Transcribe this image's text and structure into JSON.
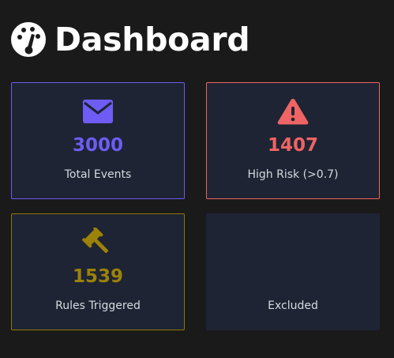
{
  "header": {
    "title": "Dashboard",
    "icon": "tachometer-icon"
  },
  "colors": {
    "background": "#1a1a1a",
    "card_background": "#1e2433",
    "total_accent": "#6b5cf0",
    "high_risk_accent": "#ef6464",
    "rules_accent": "#9c8208"
  },
  "cards": {
    "total_events": {
      "icon": "envelope-icon",
      "value": "3000",
      "label": "Total Events"
    },
    "high_risk": {
      "icon": "warning-triangle-icon",
      "value": "1407",
      "label": "High Risk (>0.7)"
    },
    "rules_triggered": {
      "icon": "gavel-icon",
      "value": "1539",
      "label": "Rules Triggered"
    },
    "excluded": {
      "value": "",
      "label": "Excluded"
    }
  }
}
